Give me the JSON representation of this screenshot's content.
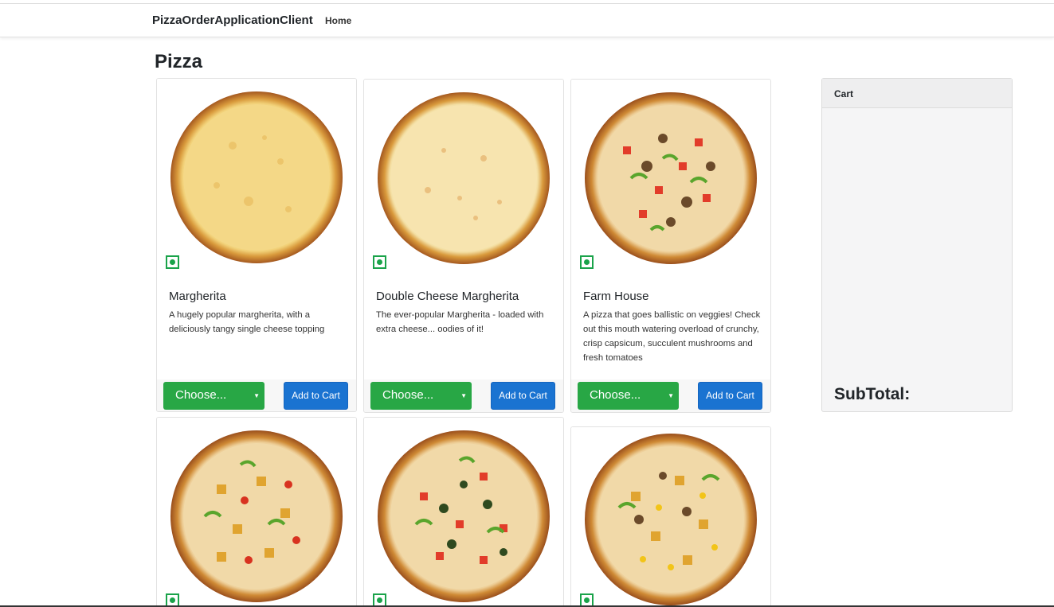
{
  "navbar": {
    "brand": "PizzaOrderApplicationClient",
    "home": "Home"
  },
  "page": {
    "title": "Pizza"
  },
  "cart": {
    "title": "Cart",
    "subtotal_label": "SubTotal:"
  },
  "colors": {
    "select_green": "#28a745",
    "button_blue": "#1a73d1",
    "veg_mark": "#1aa34a"
  },
  "pizzas": [
    {
      "name": "Margherita",
      "description": "A hugely popular margherita, with a deliciously tangy single cheese topping",
      "select_label": "Choose...",
      "button_label": "Add to Cart",
      "topping": "cheese"
    },
    {
      "name": "Double Cheese Margherita",
      "description": "The ever-popular Margherita - loaded with extra cheese... oodies of it!",
      "select_label": "Choose...",
      "button_label": "Add to Cart",
      "topping": "double-cheese"
    },
    {
      "name": "Farm House",
      "description": "A pizza that goes ballistic on veggies! Check out this mouth watering overload of crunchy, crisp capsicum, succulent mushrooms and fresh tomatoes",
      "select_label": "Choose...",
      "button_label": "Add to Cart",
      "topping": "veggie"
    },
    {
      "topping": "paneer"
    },
    {
      "topping": "mexican"
    },
    {
      "topping": "paneer-corn"
    }
  ]
}
